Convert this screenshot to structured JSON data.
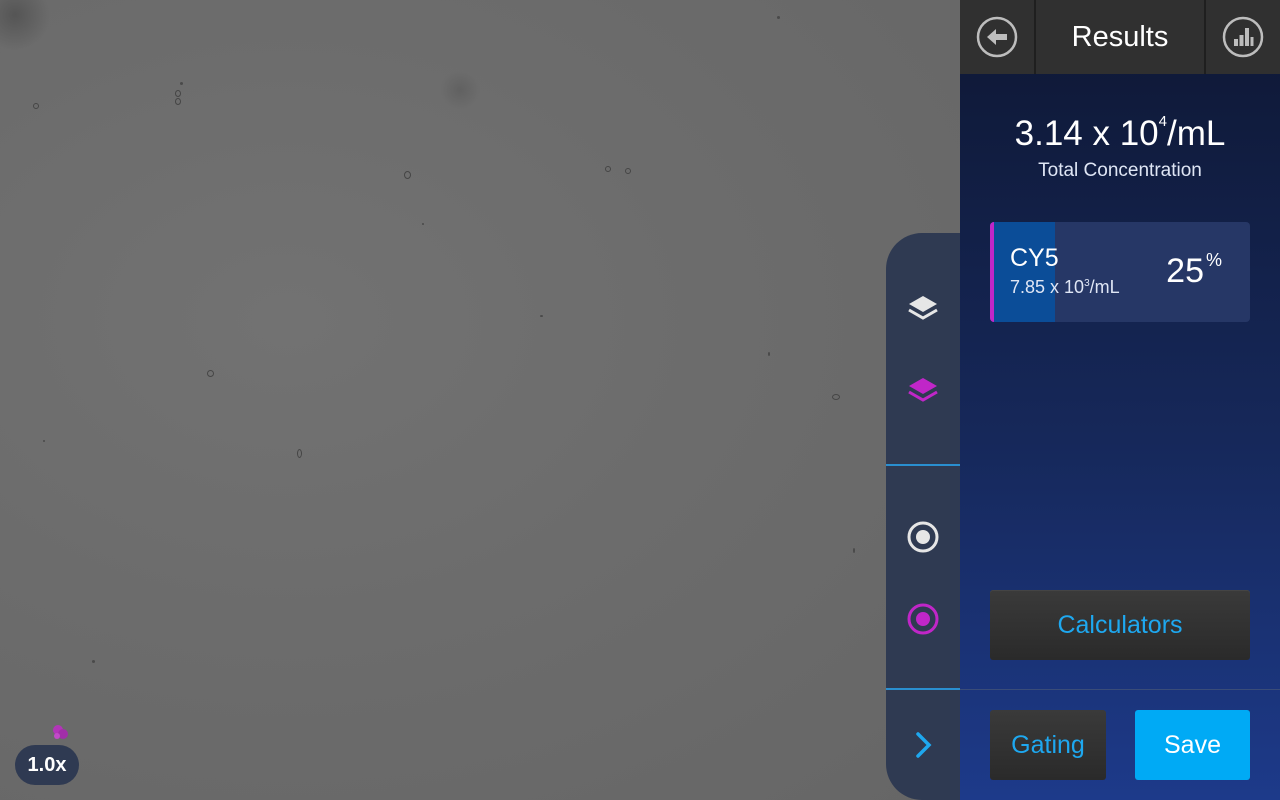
{
  "viewer": {
    "zoom_label": "1.0x"
  },
  "header": {
    "title": "Results",
    "back_icon": "back-arrow-icon",
    "chart_icon": "bar-chart-icon"
  },
  "results": {
    "total_value_base": "3.14 x 10",
    "total_value_exp": "4",
    "total_value_unit": "/mL",
    "total_label": "Total Concentration",
    "channel": {
      "name": "CY5",
      "conc_base": "7.85 x 10",
      "conc_exp": "3",
      "conc_unit": "/mL",
      "percent_value": "25",
      "percent_sign": "%",
      "fraction": 0.25,
      "accent_color": "#c026c8"
    }
  },
  "tools": {
    "layers_all_icon": "layers-icon",
    "layers_channel_icon": "layers-magenta-icon",
    "target_all_icon": "target-icon",
    "target_channel_icon": "target-magenta-icon",
    "expand_icon": "chevron-right-icon"
  },
  "footer": {
    "calculators_label": "Calculators",
    "gating_label": "Gating",
    "save_label": "Save"
  },
  "colors": {
    "accent_blue": "#00aaf5",
    "channel_magenta": "#c026c8",
    "panel_bg": "#16285a"
  }
}
